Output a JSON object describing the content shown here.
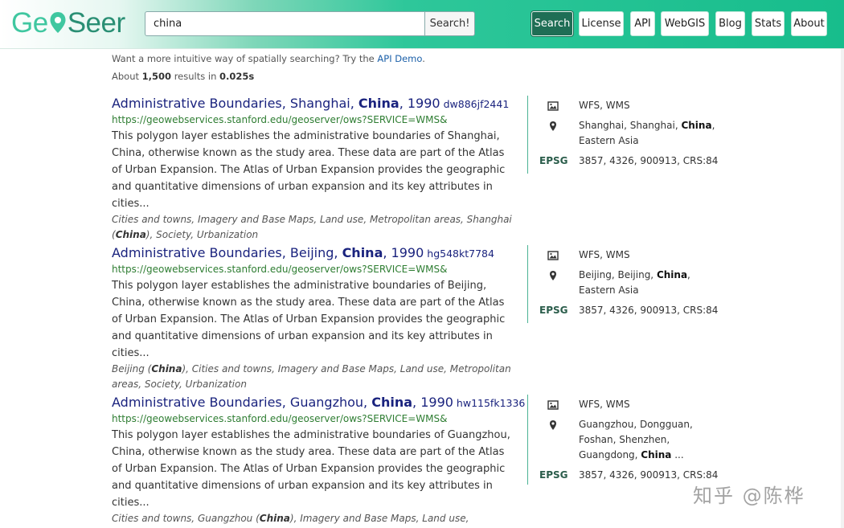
{
  "logo": {
    "part1": "Ge",
    "part2": "Seer"
  },
  "search": {
    "value": "china",
    "button": "Search!"
  },
  "nav": [
    {
      "label": "Search",
      "active": true
    },
    {
      "label": "License"
    },
    {
      "label": "API"
    },
    {
      "label": "WebGIS"
    },
    {
      "label": "Blog"
    },
    {
      "label": "Stats"
    },
    {
      "label": "About"
    }
  ],
  "hint": {
    "prefix": "Want a more intuitive way of spatially searching? Try the ",
    "link": "API Demo",
    "suffix": "."
  },
  "count": {
    "prefix": "About ",
    "results": "1,500",
    "middle": " results in ",
    "time": "0.025s"
  },
  "results": [
    {
      "title_pre": "Administrative Boundaries, Shanghai, ",
      "title_bold": "China",
      "title_post": ", 1990",
      "id": "dw886jf2441",
      "url": "https://geowebservices.stanford.edu/geoserver/ows?SERVICE=WMS&",
      "desc": "This polygon layer establishes the administrative boundaries of Shanghai, China, otherwise known as the study area. These data are part of the Atlas of Urban Expansion. The Atlas of Urban Expansion provides the geographic and quantitative dimensions of urban expansion and its key attributes in cities...",
      "tags_pre": "Cities and towns, Imagery and Base Maps, Land use, Metropolitan areas, Shanghai (",
      "tags_bold": "China",
      "tags_post": "), Society, Urbanization",
      "services": "WFS, WMS",
      "place_pre": "Shanghai, Shanghai, ",
      "place_bold": "China",
      "place_post": ", Eastern Asia",
      "epsg_label": "EPSG",
      "epsg": "3857, 4326, 900913, CRS:84"
    },
    {
      "title_pre": "Administrative Boundaries, Beijing, ",
      "title_bold": "China",
      "title_post": ", 1990",
      "id": "hg548kt7784",
      "url": "https://geowebservices.stanford.edu/geoserver/ows?SERVICE=WMS&",
      "desc": "This polygon layer establishes the administrative boundaries of Beijing, China, otherwise known as the study area. These data are part of the Atlas of Urban Expansion. The Atlas of Urban Expansion provides the geographic and quantitative dimensions of urban expansion and its key attributes in cities...",
      "tags_pre": "Beijing (",
      "tags_bold": "China",
      "tags_post": "), Cities and towns, Imagery and Base Maps, Land use, Metropolitan areas, Society, Urbanization",
      "services": "WFS, WMS",
      "place_pre": "Beijing, Beijing, ",
      "place_bold": "China",
      "place_post": ", Eastern Asia",
      "epsg_label": "EPSG",
      "epsg": "3857, 4326, 900913, CRS:84"
    },
    {
      "title_pre": "Administrative Boundaries, Guangzhou, ",
      "title_bold": "China",
      "title_post": ", 1990",
      "id": "hw115fk1336",
      "url": "https://geowebservices.stanford.edu/geoserver/ows?SERVICE=WMS&",
      "desc": "This polygon layer establishes the administrative boundaries of Guangzhou, China, otherwise known as the study area. These data are part of the Atlas of Urban Expansion. The Atlas of Urban Expansion provides the geographic and quantitative dimensions of urban expansion and its key attributes in cities...",
      "tags_pre": "Cities and towns, Guangzhou (",
      "tags_bold": "China",
      "tags_post": "), Imagery and Base Maps, Land use, Metropolitan areas, Society, Urbanization",
      "services": "WFS, WMS",
      "place_pre": "Guangzhou, Dongguan, Foshan, Shenzhen, Guangdong, ",
      "place_bold": "China",
      "place_post": " ...",
      "epsg_label": "EPSG",
      "epsg": "3857, 4326, 900913, CRS:84"
    }
  ],
  "watermark": "知乎 @陈桦",
  "colors": {
    "accent": "#1f6e55",
    "title": "#1a237e",
    "url": "#2e7d32",
    "logo_light": "#3fc7a0",
    "logo_dark": "#2a8f74"
  }
}
